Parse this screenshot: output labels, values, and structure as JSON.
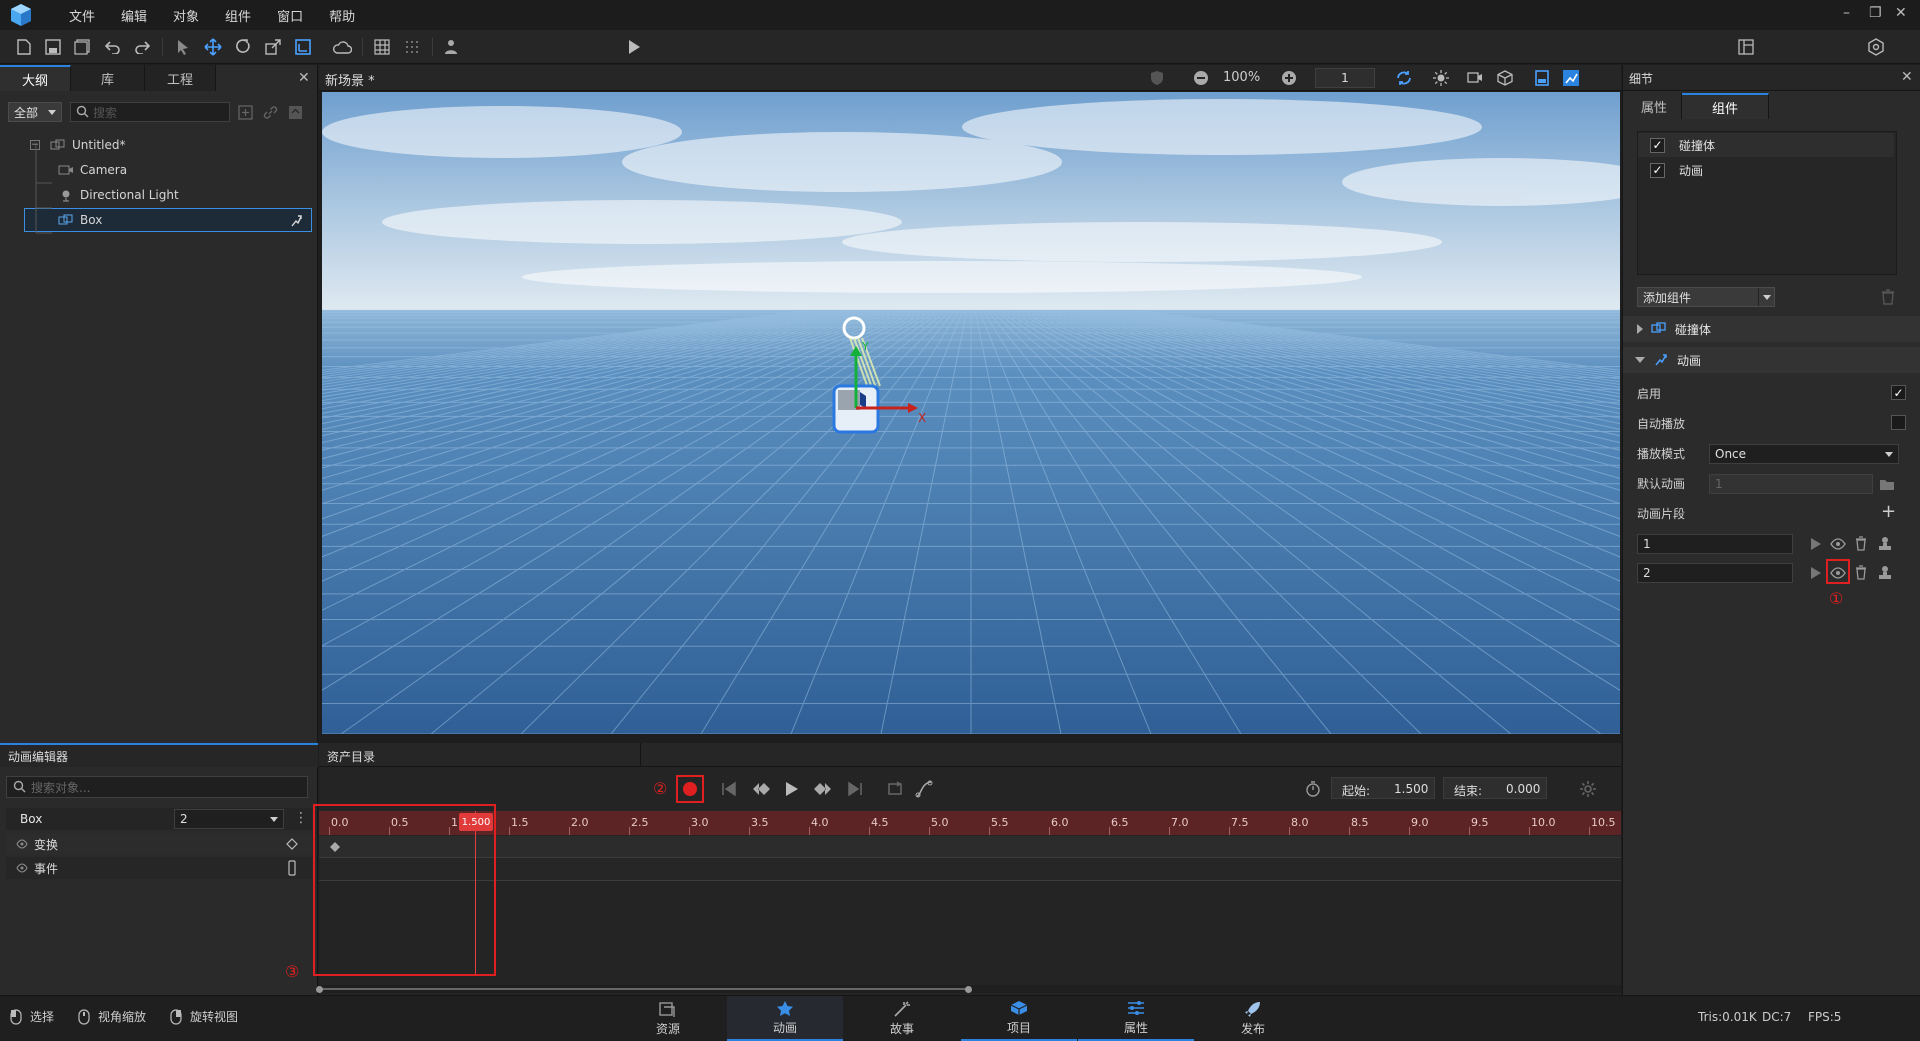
{
  "menubar": {
    "items": [
      "文件",
      "编辑",
      "对象",
      "组件",
      "窗口",
      "帮助"
    ]
  },
  "toolbar": {
    "preview_mode": "预览",
    "layout_mode": "经典"
  },
  "left_panel": {
    "tabs": [
      "大纲",
      "库",
      "工程"
    ],
    "filter": "全部",
    "search_placeholder": "搜索",
    "tree": [
      {
        "label": "Untitled*",
        "icon": "scene-icon"
      },
      {
        "label": "Camera",
        "icon": "camera-icon"
      },
      {
        "label": "Directional Light",
        "icon": "light-icon"
      },
      {
        "label": "Box",
        "icon": "mesh-icon",
        "selected": true
      }
    ]
  },
  "viewport": {
    "title": "新场景 *",
    "zoom": "100%",
    "layer_value": "1",
    "axis_x_label": "X",
    "axis_y_label": "Y"
  },
  "right_panel": {
    "title": "细节",
    "tabs": [
      "属性",
      "组件"
    ],
    "components": [
      {
        "label": "碰撞体",
        "checked": true
      },
      {
        "label": "动画",
        "checked": true
      }
    ],
    "add_component": "添加组件",
    "sections": {
      "collider": "碰撞体",
      "animation": "动画"
    },
    "props": {
      "enable_label": "启用",
      "autoplay_label": "自动播放",
      "play_mode_label": "播放模式",
      "play_mode_value": "Once",
      "default_anim_label": "默认动画",
      "default_anim_value": "1",
      "clips_label": "动画片段",
      "clips": [
        "1",
        "2"
      ]
    },
    "annotation_1": "①"
  },
  "anim_editor": {
    "title": "动画编辑器",
    "search_placeholder": "搜索对象...",
    "object_label": "Box",
    "clip_select": "2",
    "tracks": [
      "变换",
      "事件"
    ],
    "asset_tab": "资产目录",
    "start_label": "起始:",
    "start_value": "1.500",
    "end_label": "结束:",
    "end_value": "0.000",
    "playhead": "1.500",
    "ruler": [
      "0.0",
      "0.5",
      "1.0",
      "1.5",
      "2.0",
      "2.5",
      "3.0",
      "3.5",
      "4.0",
      "4.5",
      "5.0",
      "5.5",
      "6.0",
      "6.5",
      "7.0",
      "7.5",
      "8.0",
      "8.5",
      "9.0",
      "9.5",
      "10.0",
      "10.5"
    ],
    "annotation_2": "②",
    "annotation_3": "③"
  },
  "statusbar": {
    "tools": [
      "选择",
      "视角缩放",
      "旋转视图"
    ],
    "modes": [
      "资源",
      "动画",
      "故事",
      "项目",
      "属性",
      "发布"
    ],
    "stats": {
      "tris": "Tris:0.01K",
      "dc": "DC:7",
      "fps": "FPS:5"
    }
  },
  "colors": {
    "accent": "#2b83e0",
    "record_red": "#e02020",
    "timeline_red": "#6a2a2a"
  }
}
